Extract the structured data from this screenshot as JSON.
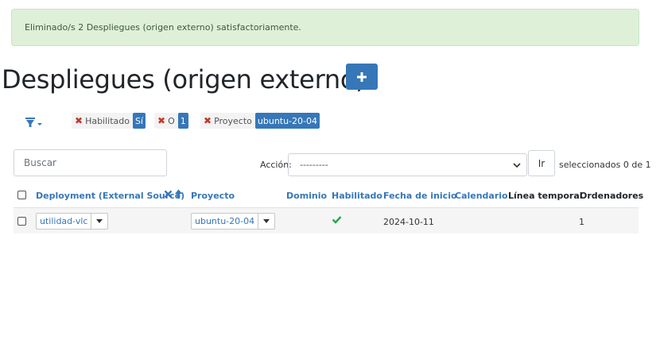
{
  "alert": {
    "message": "Eliminado/s 2 Despliegues (origen externo) satisfactoriamente."
  },
  "page": {
    "title": "Despliegues (origen externo)",
    "add_icon": "plus-icon"
  },
  "filters": {
    "toggle_icon": "filter-dropdown-icon",
    "chips": [
      {
        "label": "Habilitado",
        "value": "Sí"
      },
      {
        "label": "O",
        "value": "1"
      },
      {
        "label": "Proyecto",
        "value": "ubuntu-20-04"
      }
    ]
  },
  "toolbar": {
    "search_placeholder": "Buscar",
    "action_label": "Acción:",
    "action_selected": "---------",
    "go_label": "Ir",
    "selected_count": "seleccionados 0 de 1"
  },
  "table": {
    "columns": [
      "Deployment (External Source)",
      "Proyecto",
      "Dominio",
      "Habilitado",
      "Fecha de inicio",
      "Calendario",
      "Línea temporal",
      "Ordenadores"
    ],
    "rows": [
      {
        "deployment": "utilidad-vlc",
        "proyecto": "ubuntu-20-04",
        "dominio": "",
        "habilitado": true,
        "fecha_inicio": "2024-10-11",
        "calendario": "",
        "linea_temporal": "",
        "ordenadores": "1"
      }
    ]
  },
  "colors": {
    "accent": "#3677b8",
    "success_bg": "#dff0d8",
    "danger": "#c0392b",
    "check": "#28a745"
  }
}
